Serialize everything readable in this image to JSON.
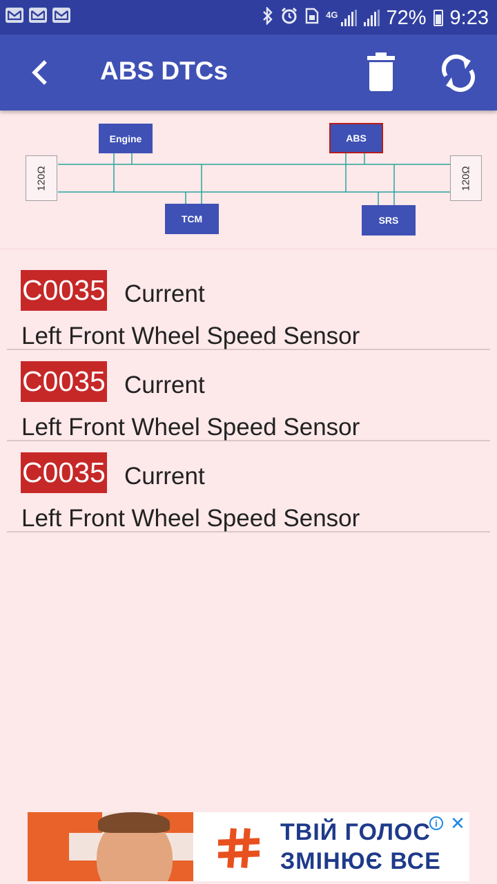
{
  "status_bar": {
    "battery": "72%",
    "time": "9:23",
    "network": "4G",
    "icons": [
      "mail-icon",
      "mail-icon",
      "mail-icon",
      "bluetooth-icon",
      "alarm-icon",
      "sim-icon",
      "network-4g-icon",
      "signal-icon",
      "signal-icon",
      "battery-icon"
    ]
  },
  "app_bar": {
    "title": "ABS DTCs",
    "icons": [
      "back-arrow-icon",
      "trash-icon",
      "refresh-icon"
    ]
  },
  "diagram": {
    "resistor_left": "120Ω",
    "resistor_right": "120Ω",
    "nodes": [
      "Engine",
      "ABS",
      "TCM",
      "SRS"
    ],
    "bus_color": "#26a69a",
    "node_color": "#3f51b5",
    "selected_node": "ABS",
    "selected_border": "#b71c1c"
  },
  "dtcs": [
    {
      "code": "C0035",
      "status": "Current",
      "description": "Left Front Wheel Speed Sensor"
    },
    {
      "code": "C0035",
      "status": "Current",
      "description": "Left Front Wheel Speed Sensor"
    },
    {
      "code": "C0035",
      "status": "Current",
      "description": "Left Front Wheel Speed Sensor"
    }
  ],
  "colors": {
    "primary": "#3f51b5",
    "primary_dark": "#303f9f",
    "background": "#fde8ea",
    "code_badge": "#c62828"
  },
  "ad": {
    "line1": "ТВІЙ ГОЛОС",
    "line2": "ЗМІНЮЄ ВСЕ",
    "info": "i",
    "close": "✕"
  }
}
